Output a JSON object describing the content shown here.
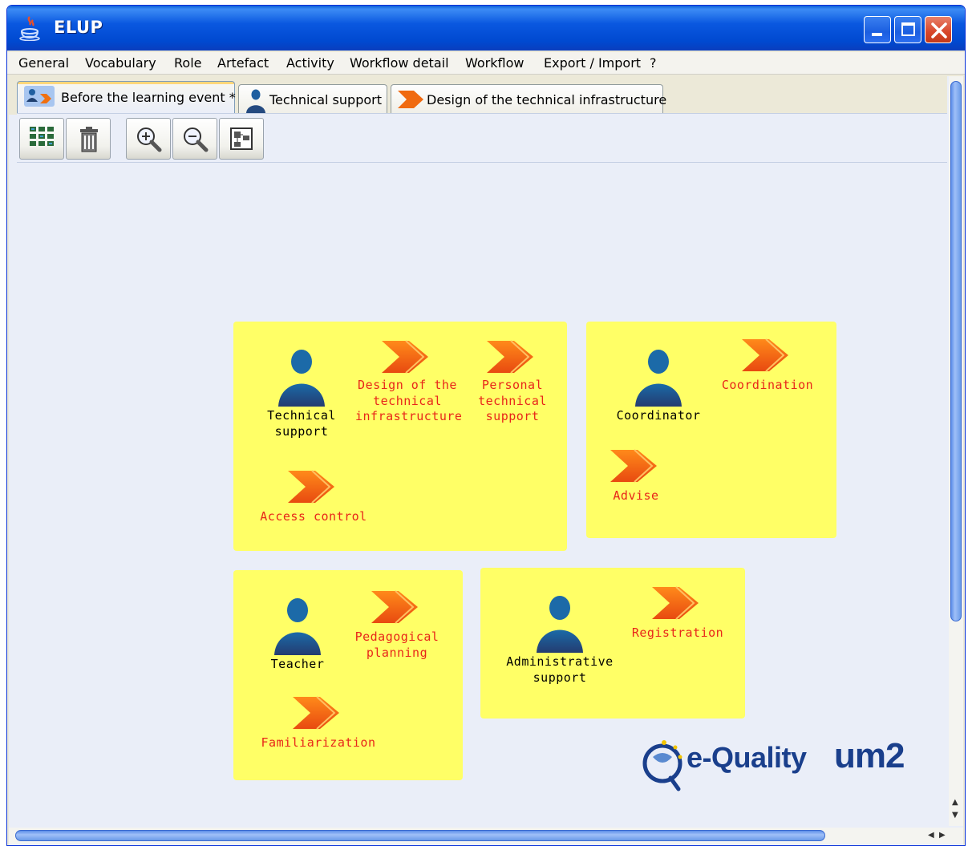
{
  "window": {
    "title": "ELUP"
  },
  "menu": [
    "General",
    "Vocabulary",
    "Role",
    "Artefact",
    "Activity",
    "Workflow detail",
    "Workflow",
    "Export / Import",
    "?"
  ],
  "tabs": [
    {
      "label": "Before the learning event *",
      "icon": "workflow-icon",
      "active": true
    },
    {
      "label": "Technical support",
      "icon": "role-person-icon",
      "active": false
    },
    {
      "label": "Design of the technical infrastructure",
      "icon": "activity-arrow-icon",
      "active": false
    }
  ],
  "toolbar": [
    "grid-icon",
    "trash-icon",
    "zoom-in-icon",
    "zoom-out-icon",
    "layout-icon"
  ],
  "colors": {
    "panel": "#ffff66",
    "activity_text": "#e8261a",
    "canvas": "#eaeef8",
    "titlebar": "#0a58e0"
  },
  "panels": {
    "p1": {
      "role": "Technical\nsupport",
      "activities": [
        "Design of the\ntechnical\ninfrastructure",
        "Personal\ntechnical\nsupport",
        "Access control"
      ]
    },
    "p2": {
      "role": "Coordinator",
      "activities": [
        "Coordination",
        "Advise"
      ]
    },
    "p3": {
      "role": "Teacher",
      "activities": [
        "Pedagogical\nplanning",
        "Familiarization"
      ]
    },
    "p4": {
      "role": "Administrative\nsupport",
      "activities": [
        "Registration"
      ]
    }
  },
  "logos": {
    "equality": "e-Quality",
    "um2": "um2"
  }
}
